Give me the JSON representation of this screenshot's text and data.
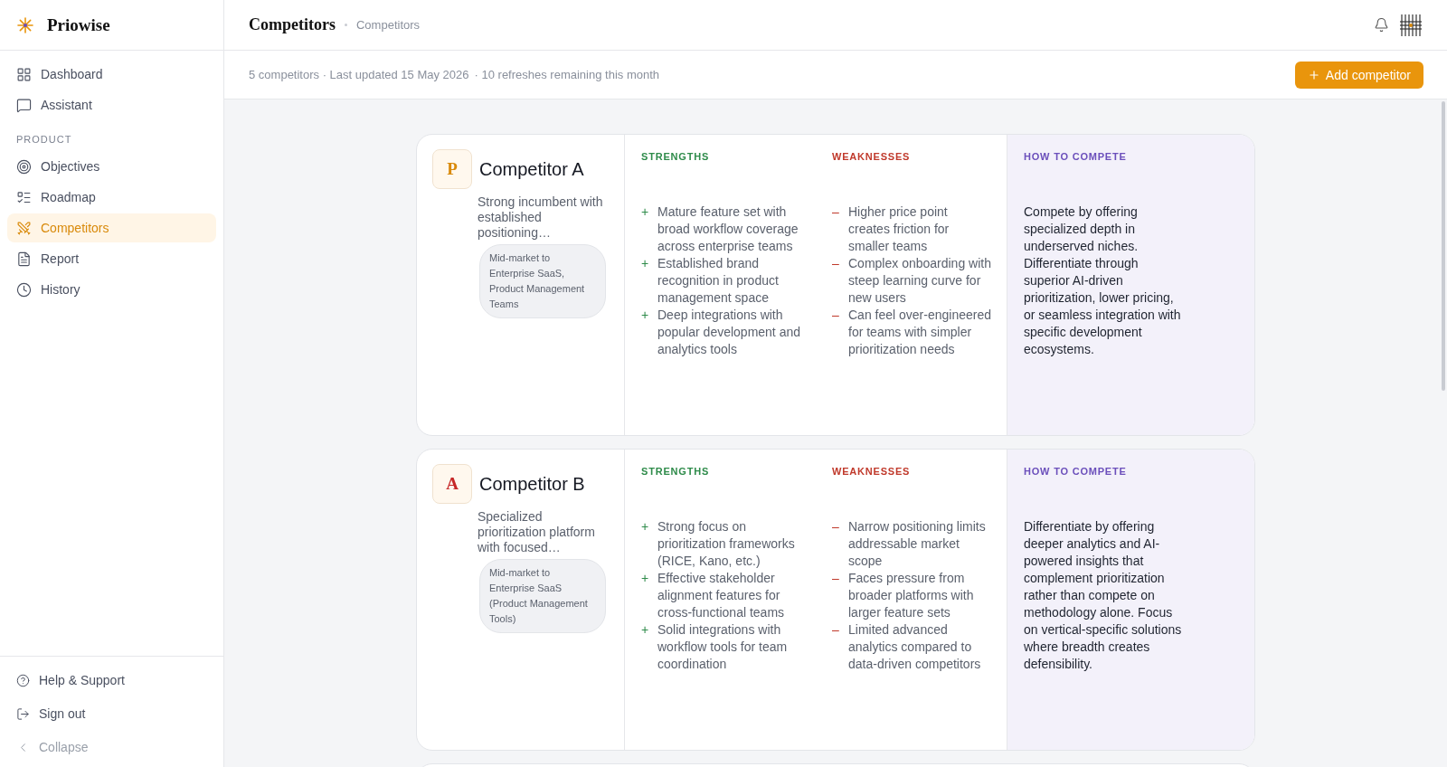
{
  "brand": {
    "name": "Priowise"
  },
  "sidebar": {
    "top_items": [
      {
        "label": "Dashboard",
        "selected": false
      },
      {
        "label": "Assistant",
        "selected": false
      }
    ],
    "section_label": "PRODUCT",
    "product_items": [
      {
        "label": "Objectives",
        "selected": false
      },
      {
        "label": "Roadmap",
        "selected": false
      },
      {
        "label": "Competitors",
        "selected": true
      },
      {
        "label": "Report",
        "selected": false
      },
      {
        "label": "History",
        "selected": false
      }
    ],
    "footer_items": [
      {
        "label": "Help & Support"
      },
      {
        "label": "Sign out"
      },
      {
        "label": "Collapse"
      }
    ]
  },
  "header": {
    "title": "Competitors",
    "breadcrumb": "Competitors"
  },
  "subheader": {
    "summary": "5 competitors · Last updated 15 May 2026",
    "refreshes": "· 10 refreshes remaining this month",
    "add_button": "Add competitor"
  },
  "competitors": [
    {
      "initial": "P",
      "color": "#d98a0b",
      "name": "Competitor A",
      "description": "Strong incumbent with established positioning…",
      "segment": "Mid-market to Enterprise SaaS, Product Management Teams",
      "strengths": {
        "heading": "STRENGTHS",
        "marker": "+",
        "items": [
          "Mature feature set with broad workflow coverage across enterprise teams",
          "Established brand recognition in product management space",
          "Deep integrations with popular development and analytics tools"
        ]
      },
      "weaknesses": {
        "heading": "WEAKNESSES",
        "marker": "–",
        "items": [
          "Higher price point creates friction for smaller teams",
          "Complex onboarding with steep learning curve for new users",
          "Can feel over-engineered for teams with simpler prioritization needs"
        ]
      },
      "how_to_compete": {
        "heading": "HOW TO COMPETE",
        "text": "Compete by offering specialized depth in underserved niches. Differentiate through superior AI-driven prioritization, lower pricing, or seamless integration with specific development ecosystems."
      }
    },
    {
      "initial": "A",
      "color": "#c62828",
      "name": "Competitor B",
      "description": "Specialized prioritization platform with focused…",
      "segment": "Mid-market to Enterprise SaaS (Product Management Tools)",
      "strengths": {
        "heading": "STRENGTHS",
        "marker": "+",
        "items": [
          "Strong focus on prioritization frameworks (RICE, Kano, etc.)",
          "Effective stakeholder alignment features for cross-functional teams",
          "Solid integrations with workflow tools for team coordination"
        ]
      },
      "weaknesses": {
        "heading": "WEAKNESSES",
        "marker": "–",
        "items": [
          "Narrow positioning limits addressable market scope",
          "Faces pressure from broader platforms with larger feature sets",
          "Limited advanced analytics compared to data-driven competitors"
        ]
      },
      "how_to_compete": {
        "heading": "HOW TO COMPETE",
        "text": "Differentiate by offering deeper analytics and AI-powered insights that complement prioritization rather than compete on methodology alone. Focus on vertical-specific solutions where breadth creates defensibility."
      }
    }
  ]
}
